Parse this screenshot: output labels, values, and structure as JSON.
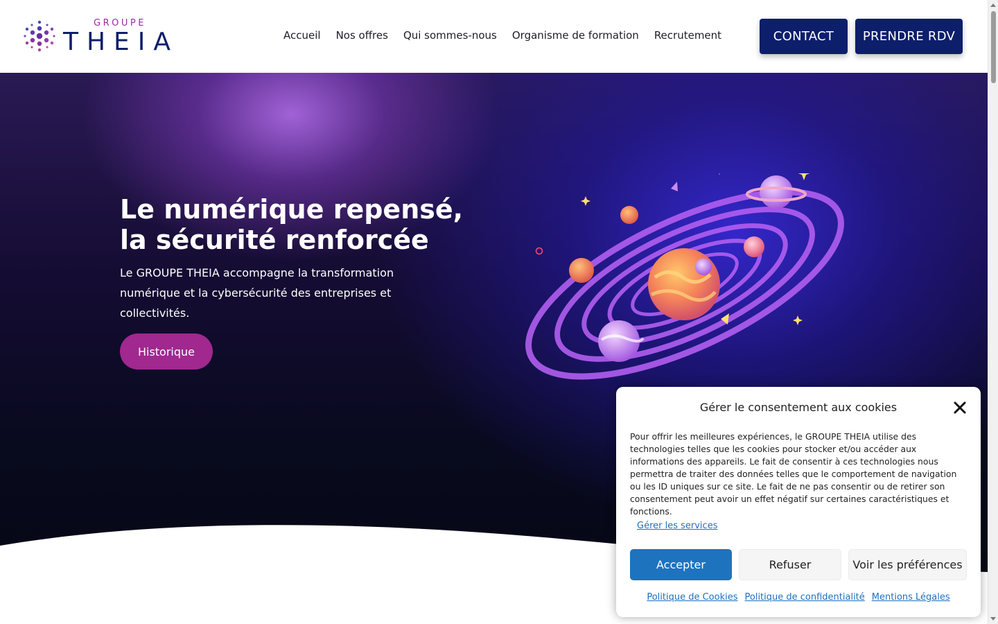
{
  "header": {
    "logo_top": "GROUPE",
    "logo_main": "THEIA",
    "nav": [
      {
        "label": "Accueil"
      },
      {
        "label": "Nos offres"
      },
      {
        "label": "Qui sommes-nous"
      },
      {
        "label": "Organisme de formation"
      },
      {
        "label": "Recrutement"
      }
    ],
    "contact_label": "CONTACT",
    "rdv_label": "PRENDRE RDV"
  },
  "hero": {
    "title_line1": "Le numérique repensé,",
    "title_line2": "la sécurité renforcée",
    "text": "Le GROUPE THEIA accompagne la transformation numérique et la cybersécurité des entreprises et collectivités.",
    "button_label": "Historique"
  },
  "cookie": {
    "title": "Gérer le consentement aux cookies",
    "body": "Pour offrir les meilleures expériences, le GROUPE THEIA utilise des technologies telles que les cookies pour stocker et/ou accéder aux informations des appareils. Le fait de consentir à ces technologies nous permettra de traiter des données telles que le comportement de navigation ou les ID uniques sur ce site. Le fait de ne pas consentir ou de retirer son consentement peut avoir un effet négatif sur certaines caractéristiques et fonctions.",
    "manage_label": "Gérer les services",
    "accept_label": "Accepter",
    "refuse_label": "Refuser",
    "prefs_label": "Voir les préférences",
    "links": [
      {
        "label": "Politique de Cookies"
      },
      {
        "label": "Politique de confidentialité"
      },
      {
        "label": "Mentions Légales"
      }
    ]
  },
  "colors": {
    "brand_navy": "#0d1f6b",
    "brand_magenta": "#a0288f",
    "accept_blue": "#1e73be"
  }
}
